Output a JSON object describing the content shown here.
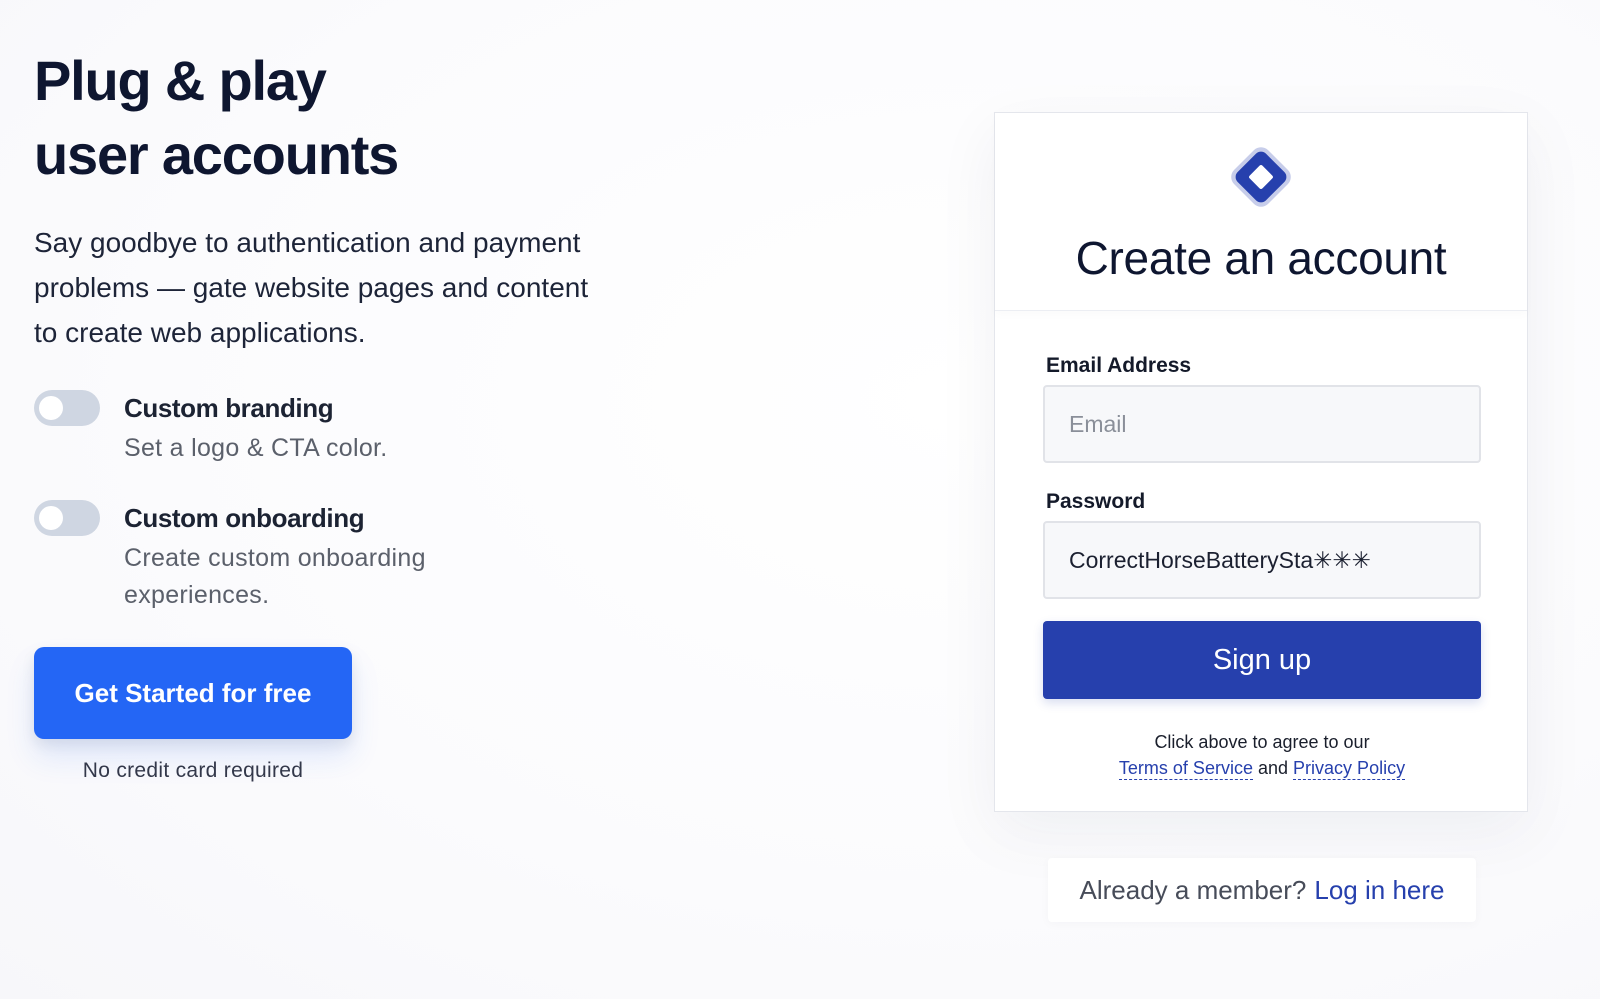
{
  "hero": {
    "headline_line1": "Plug & play",
    "headline_line2": "user accounts",
    "subtext": "Say goodbye to authentication and payment problems — gate website pages and content to create web applications."
  },
  "features": [
    {
      "title": "Custom branding",
      "description": "Set a logo & CTA color.",
      "enabled": false
    },
    {
      "title": "Custom onboarding",
      "description": "Create custom onboarding experiences.",
      "enabled": false
    }
  ],
  "cta": {
    "label": "Get Started for free",
    "note": "No credit card required",
    "color": "#2466f5"
  },
  "signup_card": {
    "logo_icon": "diamond-logo-icon",
    "title": "Create an account",
    "email": {
      "label": "Email Address",
      "placeholder": "Email",
      "value": ""
    },
    "password": {
      "label": "Password",
      "value": "CorrectHorseBatterySta✳✳✳"
    },
    "submit_label": "Sign up",
    "legal_prefix": "Click above to agree to our",
    "terms_label": "Terms of Service",
    "legal_and": "and",
    "privacy_label": "Privacy Policy",
    "accent": "#2640ad"
  },
  "member": {
    "prompt": "Already a member?",
    "link_label": "Log in here"
  }
}
